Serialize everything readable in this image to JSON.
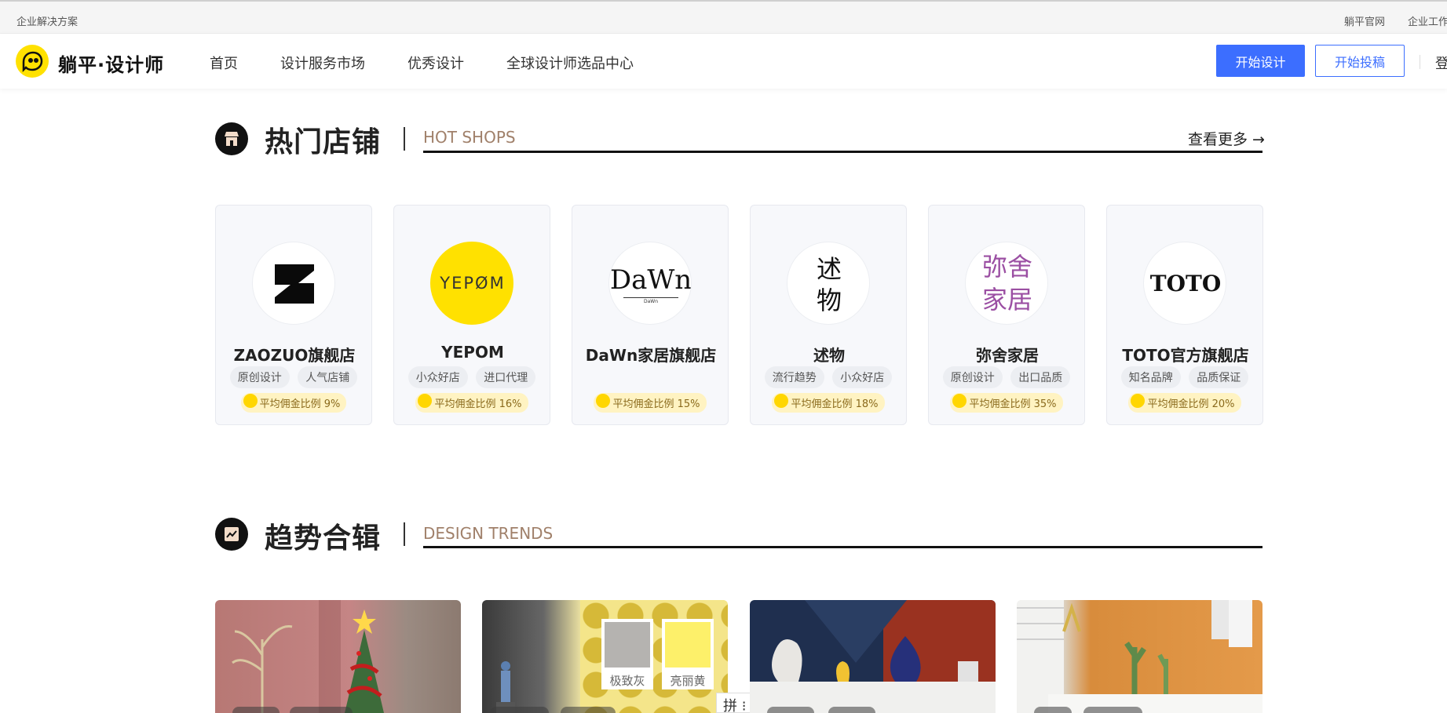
{
  "topbar": {
    "left_link": "企业解决方案",
    "right_link_1": "躺平官网",
    "right_link_2": "企业工作台"
  },
  "header": {
    "brand": "躺平·设计师",
    "nav": [
      "首页",
      "设计服务市场",
      "优秀设计",
      "全球设计师选品中心"
    ],
    "start_design": "开始设计",
    "start_submit": "开始投稿",
    "login": "登"
  },
  "hot_shops": {
    "title": "热门店铺",
    "subtitle": "HOT SHOPS",
    "more": "查看更多 →",
    "shops": [
      {
        "name": "ZAOZUO旗舰店",
        "tags": [
          "原创设计",
          "人气店铺"
        ],
        "commission": "平均佣金比例 9%"
      },
      {
        "name": "YEPOM",
        "logo_text": "YEPØM",
        "tags": [
          "小众好店",
          "进口代理"
        ],
        "commission": "平均佣金比例 16%"
      },
      {
        "name": "DaWn家居旗舰店",
        "logo_text": "DaWn",
        "logo_sub": "DaWn",
        "tags": [],
        "commission": "平均佣金比例 15%"
      },
      {
        "name": "述物",
        "logo_text": "述物",
        "tags": [
          "流行趋势",
          "小众好店"
        ],
        "commission": "平均佣金比例 18%"
      },
      {
        "name": "弥舍家居",
        "logo_text": "弥舍家居",
        "tags": [
          "原创设计",
          "出口品质"
        ],
        "commission": "平均佣金比例 35%"
      },
      {
        "name": "TOTO官方旗舰店",
        "logo_text": "TOTO",
        "tags": [
          "知名品牌",
          "品质保证"
        ],
        "commission": "平均佣金比例 20%"
      }
    ]
  },
  "trends": {
    "title": "趋势合辑",
    "subtitle": "DESIGN TRENDS",
    "swatches": [
      {
        "label": "极致灰",
        "color": "#b5b3b0"
      },
      {
        "label": "亮丽黄",
        "color": "#fdf06a"
      }
    ],
    "ime_text": "拼 ⁝"
  }
}
